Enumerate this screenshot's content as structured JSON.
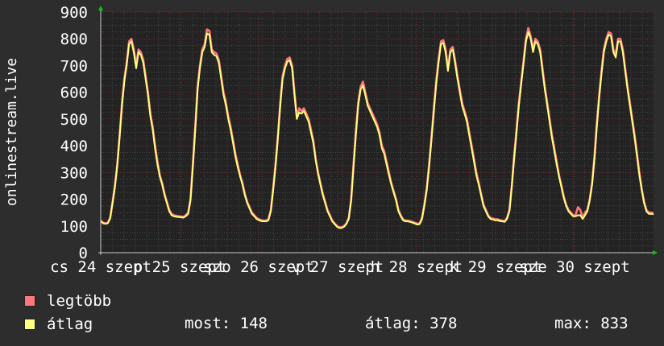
{
  "chart_data": {
    "type": "line",
    "ylabel": "onlinestream.live",
    "ylim": [
      0,
      900
    ],
    "y_ticks": [
      0,
      100,
      200,
      300,
      400,
      500,
      600,
      700,
      800,
      900
    ],
    "grid": true,
    "x_tick_labels": [
      "cs 24 szept",
      "p 25 szept",
      "szo 26 szept",
      "v 27 szept",
      "h 28 szept",
      "k 29 szept",
      "sze 30 szept"
    ],
    "x_start_label": "cs 24 szept",
    "series": [
      {
        "name": "legtöbb",
        "color": "#ff7777",
        "values": [
          120,
          112,
          110,
          112,
          130,
          190,
          250,
          330,
          440,
          560,
          650,
          710,
          790,
          800,
          760,
          700,
          760,
          750,
          720,
          660,
          600,
          520,
          470,
          400,
          340,
          290,
          260,
          220,
          190,
          160,
          145,
          140,
          138,
          136,
          135,
          134,
          140,
          150,
          200,
          330,
          470,
          620,
          700,
          760,
          780,
          835,
          830,
          760,
          750,
          745,
          720,
          660,
          600,
          560,
          510,
          470,
          420,
          370,
          330,
          290,
          260,
          220,
          190,
          170,
          150,
          140,
          130,
          125,
          122,
          120,
          120,
          125,
          160,
          240,
          330,
          440,
          560,
          660,
          700,
          725,
          730,
          700,
          600,
          510,
          540,
          530,
          540,
          520,
          500,
          460,
          420,
          350,
          300,
          260,
          220,
          190,
          160,
          140,
          120,
          110,
          100,
          95,
          95,
          100,
          110,
          130,
          200,
          330,
          450,
          560,
          620,
          640,
          600,
          560,
          540,
          520,
          500,
          480,
          450,
          400,
          380,
          340,
          300,
          260,
          230,
          200,
          160,
          140,
          125,
          120,
          120,
          118,
          115,
          112,
          108,
          110,
          130,
          180,
          240,
          330,
          430,
          540,
          640,
          720,
          790,
          795,
          760,
          690,
          760,
          770,
          720,
          660,
          610,
          560,
          530,
          500,
          450,
          400,
          350,
          300,
          260,
          220,
          180,
          160,
          140,
          130,
          128,
          125,
          125,
          122,
          120,
          118,
          130,
          160,
          250,
          360,
          460,
          560,
          640,
          720,
          800,
          840,
          810,
          760,
          800,
          790,
          760,
          690,
          620,
          560,
          500,
          440,
          390,
          340,
          290,
          250,
          210,
          180,
          160,
          150,
          140,
          140,
          170,
          160,
          130,
          150,
          160,
          200,
          260,
          360,
          480,
          590,
          680,
          760,
          800,
          825,
          820,
          760,
          740,
          800,
          800,
          760,
          690,
          620,
          560,
          500,
          440,
          370,
          300,
          240,
          190,
          160,
          150,
          150,
          148
        ]
      },
      {
        "name": "átlag",
        "color": "#ffff80",
        "values": [
          118,
          110,
          108,
          110,
          128,
          185,
          245,
          325,
          435,
          550,
          640,
          700,
          780,
          790,
          750,
          690,
          750,
          740,
          710,
          650,
          590,
          510,
          460,
          390,
          330,
          285,
          255,
          215,
          185,
          155,
          140,
          136,
          134,
          133,
          132,
          131,
          136,
          145,
          195,
          320,
          460,
          610,
          690,
          750,
          770,
          820,
          815,
          750,
          740,
          735,
          710,
          650,
          590,
          550,
          500,
          460,
          410,
          360,
          320,
          285,
          255,
          215,
          185,
          165,
          145,
          136,
          126,
          121,
          118,
          117,
          117,
          121,
          155,
          235,
          320,
          430,
          550,
          650,
          690,
          715,
          720,
          690,
          590,
          500,
          525,
          520,
          530,
          510,
          490,
          450,
          410,
          345,
          295,
          255,
          215,
          185,
          155,
          136,
          117,
          107,
          97,
          92,
          92,
          97,
          107,
          126,
          195,
          320,
          440,
          550,
          610,
          625,
          590,
          550,
          530,
          510,
          490,
          470,
          440,
          390,
          370,
          330,
          290,
          255,
          225,
          195,
          155,
          136,
          121,
          117,
          117,
          115,
          112,
          109,
          105,
          107,
          126,
          175,
          235,
          320,
          420,
          530,
          630,
          710,
          780,
          785,
          750,
          680,
          750,
          760,
          710,
          650,
          600,
          550,
          520,
          490,
          440,
          390,
          340,
          290,
          255,
          215,
          175,
          155,
          136,
          126,
          124,
          121,
          121,
          118,
          117,
          115,
          126,
          155,
          245,
          350,
          450,
          550,
          630,
          710,
          790,
          825,
          800,
          750,
          790,
          780,
          750,
          680,
          610,
          550,
          490,
          430,
          380,
          330,
          285,
          245,
          205,
          175,
          155,
          145,
          136,
          136,
          140,
          140,
          126,
          140,
          155,
          195,
          255,
          350,
          470,
          580,
          670,
          750,
          790,
          815,
          810,
          750,
          730,
          790,
          790,
          750,
          680,
          610,
          550,
          490,
          430,
          360,
          290,
          235,
          185,
          155,
          145,
          145,
          144
        ]
      }
    ]
  },
  "legend": {
    "items": [
      {
        "label": "legtöbb",
        "color": "#ff7777"
      },
      {
        "label": "átlag",
        "color": "#ffff80"
      }
    ]
  },
  "stats": {
    "most": "most: 148",
    "atlag": "átlag: 378",
    "max": "max: 833"
  }
}
